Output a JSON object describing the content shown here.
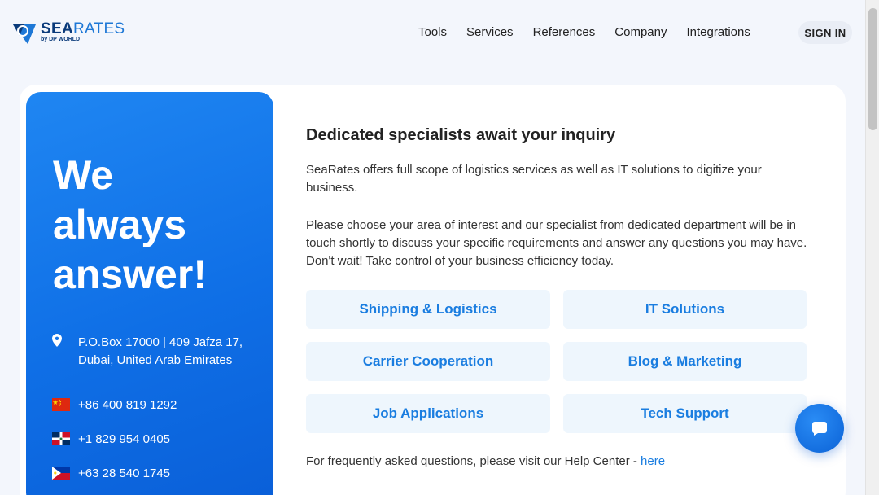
{
  "header": {
    "logo": {
      "brand_main": "SEA",
      "brand_rest": "RATES",
      "tagline": "by DP WORLD",
      "icon": "searates-logo-icon"
    },
    "nav": [
      "Tools",
      "Services",
      "References",
      "Company",
      "Integrations"
    ],
    "signin_label": "SIGN IN"
  },
  "panel": {
    "headline_line1": "We",
    "headline_line2": "always",
    "headline_line3": "answer!",
    "address_line1": "P.O.Box 17000 | 409 Jafza 17,",
    "address_line2": "Dubai, United Arab Emirates",
    "phones": [
      {
        "number": "+86 400 819 1292",
        "flag": "china-flag-icon"
      },
      {
        "number": "+1 829 954 0405",
        "flag": "dominican-republic-flag-icon"
      },
      {
        "number": "+63 28 540 1745",
        "flag": "philippines-flag-icon"
      }
    ]
  },
  "main": {
    "heading": "Dedicated specialists await your inquiry",
    "paragraph1": "SeaRates offers full scope of logistics services as well as IT solutions to digitize your business.",
    "paragraph2": "Please choose your area of interest and our specialist from dedicated department will be in touch shortly to discuss your specific requirements and answer any questions you may have. Don't wait! Take control of your business efficiency today.",
    "options": [
      "Shipping & Logistics",
      "IT Solutions",
      "Carrier Cooperation",
      "Blog & Marketing",
      "Job Applications",
      "Tech Support"
    ],
    "faq_text": "For frequently asked questions, please visit our Help Center - ",
    "faq_link": "here"
  },
  "colors": {
    "accent": "#1a7de0",
    "panel_blue": "#1274ea",
    "option_bg": "#eef6fd"
  }
}
